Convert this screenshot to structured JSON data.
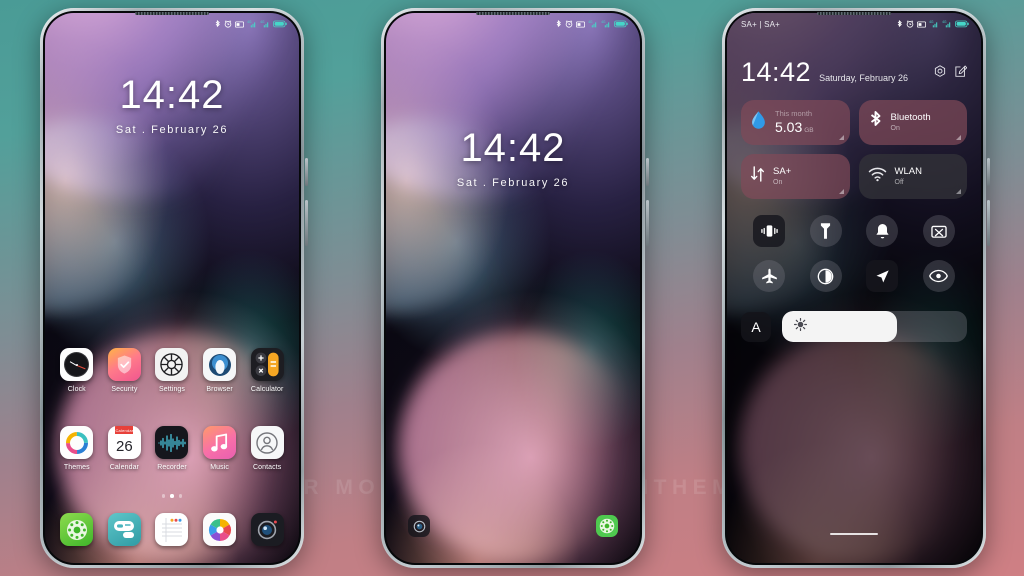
{
  "watermark": "VISIT FOR MORE THEMES - MIUITHEMER.COM",
  "colors": {
    "bg_top": "#4a9b96",
    "bg_bottom": "#cf7f84",
    "tile_active": "#804a58",
    "tile_inactive": "#34343a",
    "accent_green": "#4fc94f",
    "accent_blue": "#3a9ce8"
  },
  "phone1": {
    "name": "Home screen",
    "statusbar": {
      "left": "",
      "icons": [
        "bluetooth-icon",
        "alarm-icon",
        "sim-icon",
        "signal-4g-icon",
        "signal-4g-2-icon",
        "battery-icon"
      ]
    },
    "clock": {
      "time": "14:42",
      "date": "Sat . February 26"
    },
    "apps_row1": [
      {
        "label": "Clock",
        "icon": "clock-icon"
      },
      {
        "label": "Security",
        "icon": "shield-check-icon"
      },
      {
        "label": "Settings",
        "icon": "gear-icon"
      },
      {
        "label": "Browser",
        "icon": "globe-icon"
      },
      {
        "label": "Calculator",
        "icon": "calculator-icon"
      }
    ],
    "apps_row2": [
      {
        "label": "Themes",
        "icon": "themes-ring-icon"
      },
      {
        "label": "Calendar",
        "icon": "calendar-icon",
        "day": "26",
        "month": "Calendar"
      },
      {
        "label": "Recorder",
        "icon": "waveform-icon"
      },
      {
        "label": "Music",
        "icon": "music-note-icon"
      },
      {
        "label": "Contacts",
        "icon": "person-circle-icon"
      }
    ],
    "page_dots": {
      "count": 3,
      "active_index": 1
    },
    "dock": [
      {
        "label": "Phone",
        "icon": "dialpad-icon"
      },
      {
        "label": "Messages",
        "icon": "message-bubble-icon"
      },
      {
        "label": "Notes",
        "icon": "notes-icon"
      },
      {
        "label": "Gallery",
        "icon": "color-wheel-icon"
      },
      {
        "label": "Camera",
        "icon": "camera-icon"
      }
    ]
  },
  "phone2": {
    "name": "Lock screen",
    "statusbar": {
      "left": "",
      "icons": [
        "bluetooth-icon",
        "alarm-icon",
        "sim-icon",
        "signal-4g-icon",
        "signal-4g-2-icon",
        "battery-icon"
      ]
    },
    "clock": {
      "time": "14:42",
      "date": "Sat . February 26"
    },
    "shortcuts": [
      {
        "name": "camera-shortcut",
        "icon": "camera-icon"
      },
      {
        "name": "torch-shortcut",
        "icon": "dialpad-icon"
      }
    ]
  },
  "phone3": {
    "name": "Control center",
    "statusbar": {
      "left": "SA+ | SA+",
      "icons": [
        "bluetooth-icon",
        "alarm-icon",
        "sim-icon",
        "signal-4g-icon",
        "signal-4g-2-icon",
        "battery-icon"
      ]
    },
    "header": {
      "time": "14:42",
      "date": "Saturday, February 26",
      "icons": [
        "settings-hex-icon",
        "edit-icon"
      ]
    },
    "tiles": [
      {
        "title": "5.03",
        "unit": "GB",
        "sub": "This month",
        "icon": "data-drop-icon",
        "state": "on"
      },
      {
        "title": "Bluetooth",
        "sub": "On",
        "icon": "bluetooth-icon",
        "state": "on"
      },
      {
        "title": "SA+",
        "sub": "On",
        "icon": "mobile-data-icon",
        "state": "on"
      },
      {
        "title": "WLAN",
        "sub": "Off",
        "icon": "wifi-icon",
        "state": "off"
      }
    ],
    "toggles": [
      {
        "name": "vibrate-toggle",
        "icon": "vibrate-icon",
        "style": "square"
      },
      {
        "name": "flashlight-toggle",
        "icon": "flashlight-icon",
        "style": "circle"
      },
      {
        "name": "ringer-toggle",
        "icon": "bell-icon",
        "style": "circle"
      },
      {
        "name": "screenshot-toggle",
        "icon": "screenshot-icon",
        "style": "circle"
      },
      {
        "name": "airplane-toggle",
        "icon": "airplane-icon",
        "style": "circle"
      },
      {
        "name": "dark-mode-toggle",
        "icon": "contrast-circle-icon",
        "style": "circle"
      },
      {
        "name": "location-toggle",
        "icon": "location-arrow-icon",
        "style": "square"
      },
      {
        "name": "reading-mode-toggle",
        "icon": "eye-icon",
        "style": "circle"
      }
    ],
    "brightness": {
      "auto_label": "A",
      "icon": "sun-icon",
      "value_percent": 62
    }
  }
}
